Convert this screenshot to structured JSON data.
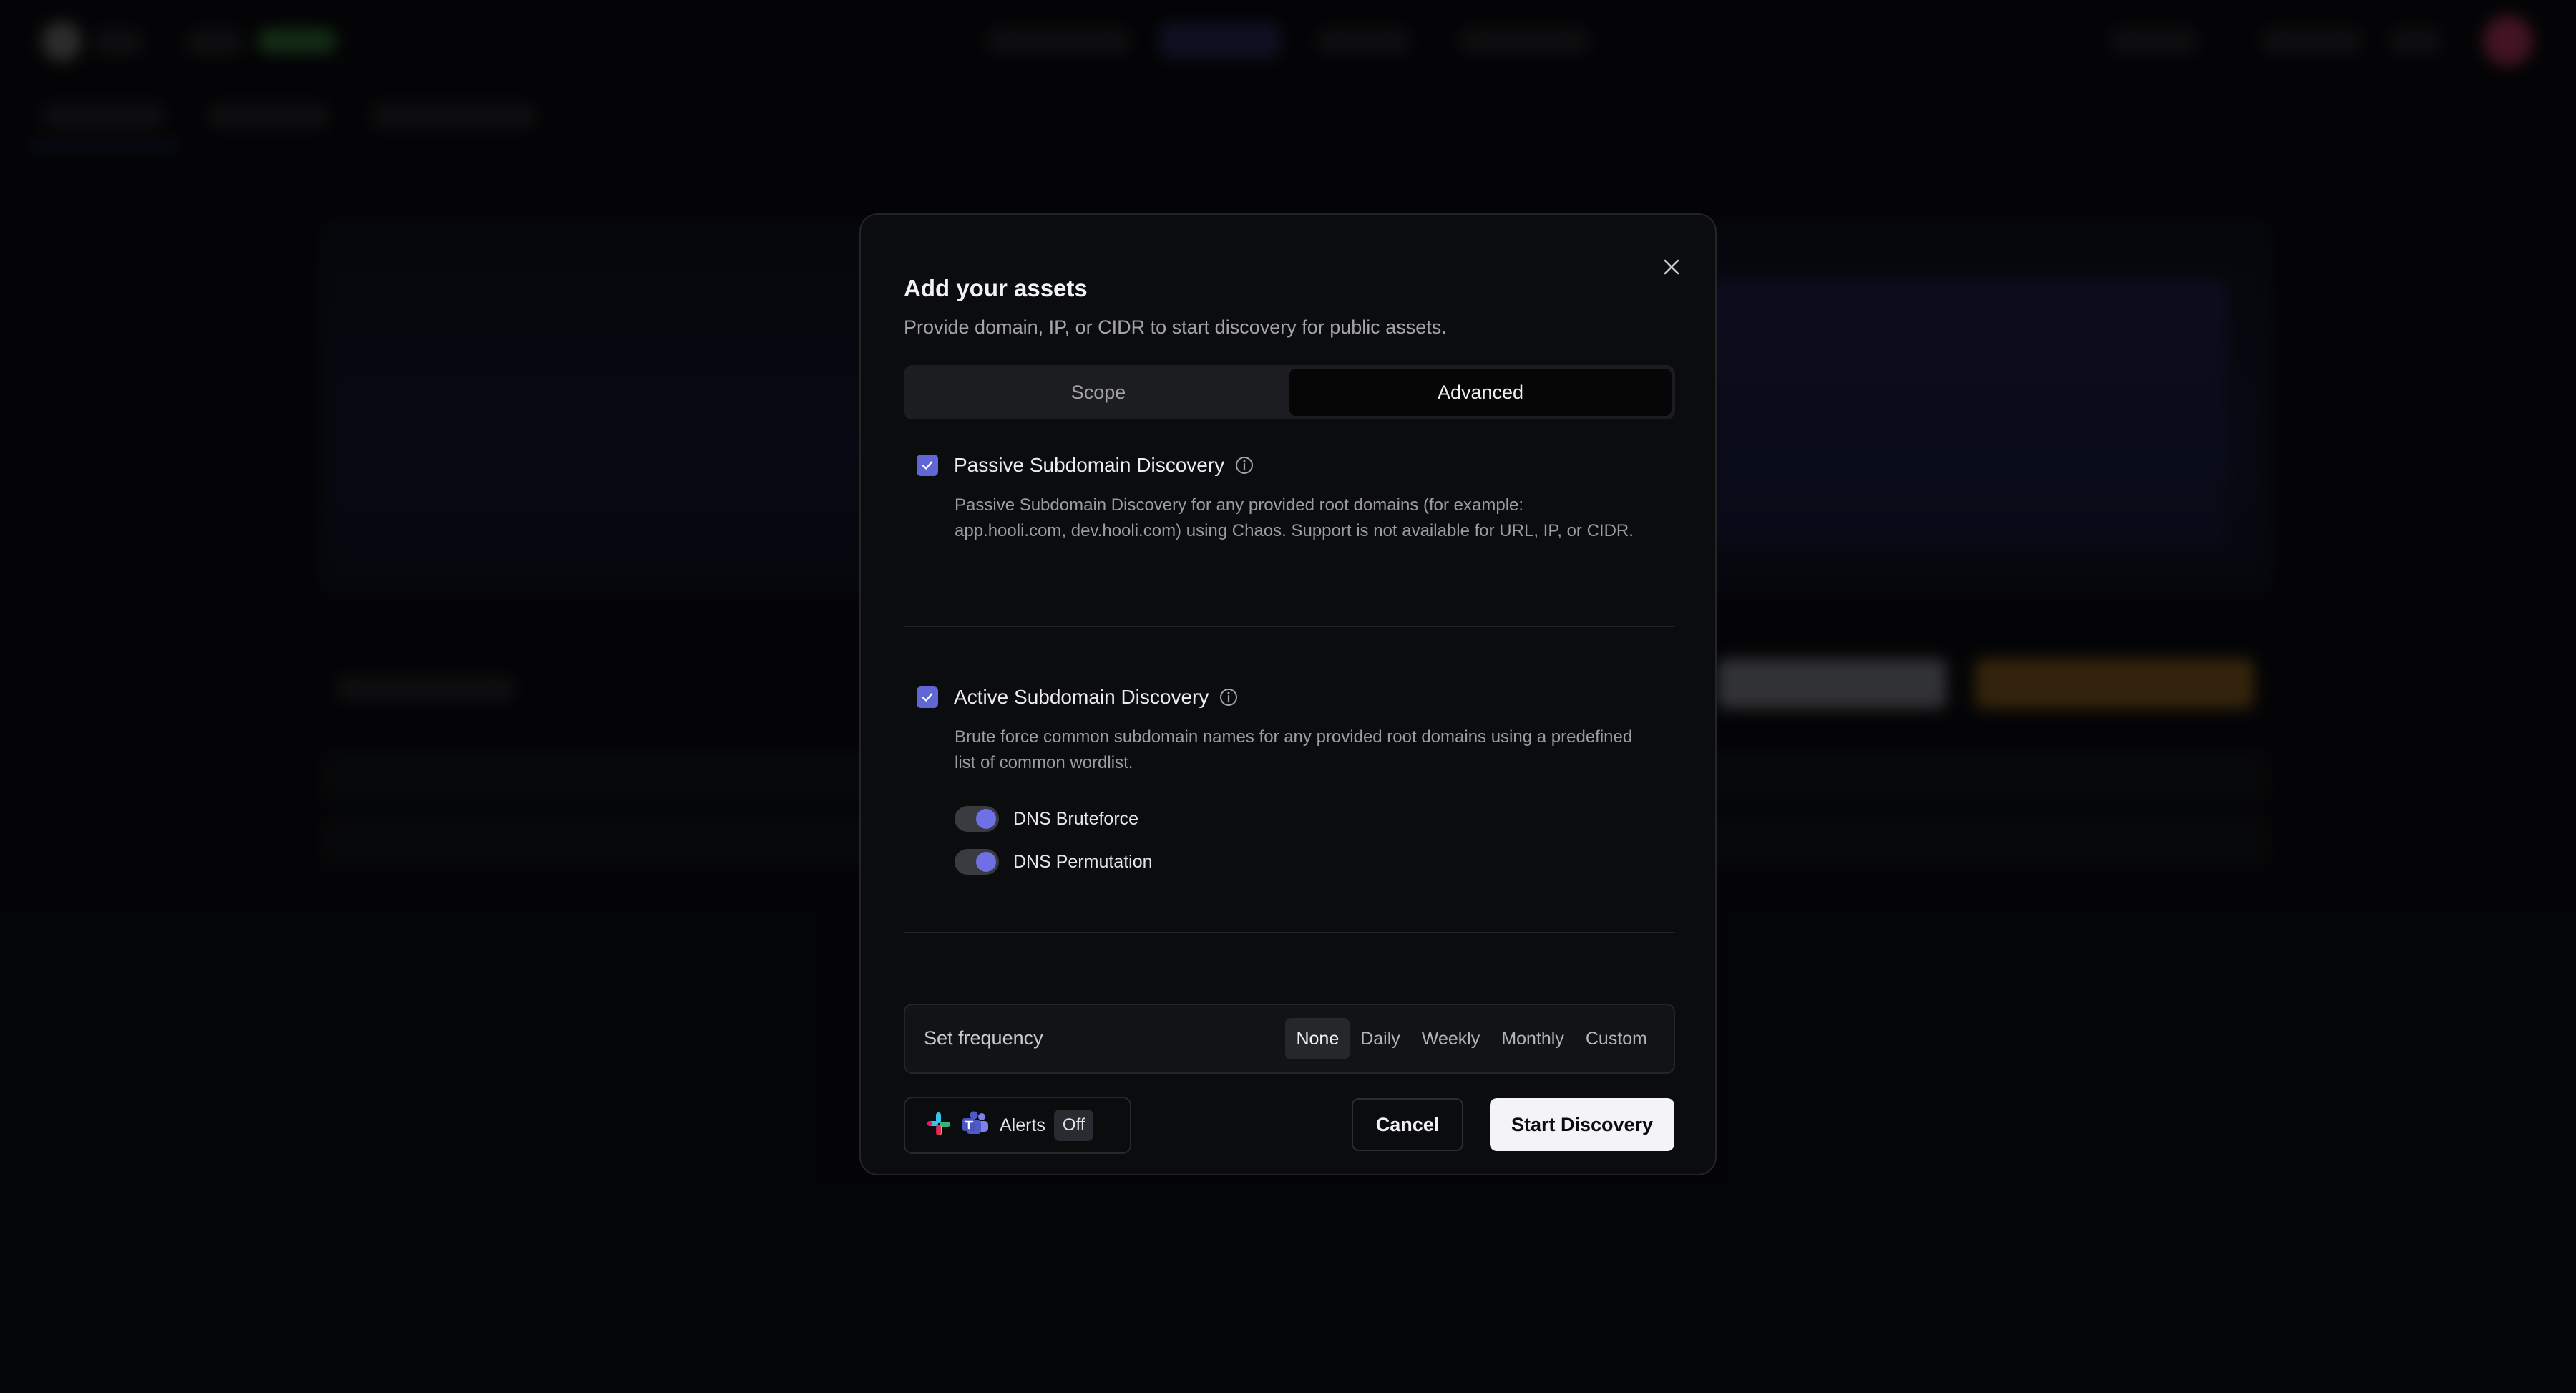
{
  "modal": {
    "title": "Add your assets",
    "subtitle": "Provide domain, IP, or CIDR to start discovery for public assets.",
    "close_icon": "close-icon",
    "tabs": [
      {
        "label": "Scope",
        "active": false
      },
      {
        "label": "Advanced",
        "active": true
      }
    ],
    "passive": {
      "label": "Passive Subdomain Discovery",
      "checked": true,
      "description": "Passive Subdomain Discovery for any provided root domains (for example: app.hooli.com, dev.hooli.com) using Chaos. Support is not available for URL, IP, or CIDR."
    },
    "active": {
      "label": "Active Subdomain Discovery",
      "checked": true,
      "description": "Brute force common subdomain names for any provided root domains using a predefined list of common wordlist.",
      "toggles": [
        {
          "label": "DNS Bruteforce",
          "on": true
        },
        {
          "label": "DNS Permutation",
          "on": true
        }
      ]
    },
    "frequency": {
      "label": "Set frequency",
      "options": [
        "None",
        "Daily",
        "Weekly",
        "Monthly",
        "Custom"
      ],
      "selected": "None"
    },
    "alerts": {
      "label": "Alerts",
      "status": "Off",
      "icons": [
        "slack-icon",
        "teams-icon"
      ]
    },
    "buttons": {
      "cancel": "Cancel",
      "start": "Start Discovery"
    }
  },
  "colors": {
    "accent": "#6166d6",
    "modal_bg": "#0b0c0e",
    "primary_button": "#f4f4f6"
  }
}
